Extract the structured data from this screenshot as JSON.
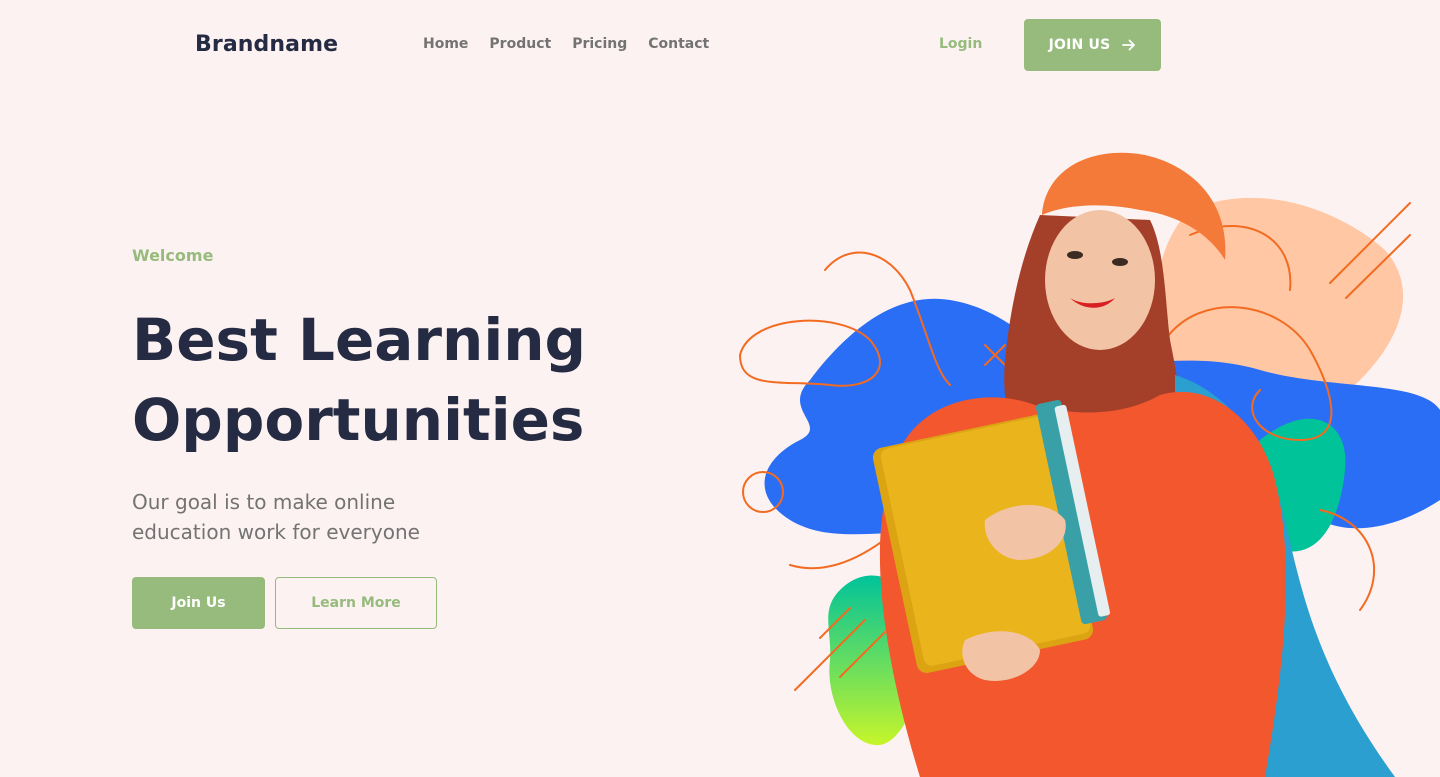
{
  "header": {
    "brand": "Brandname",
    "nav": [
      "Home",
      "Product",
      "Pricing",
      "Contact"
    ],
    "login_label": "Login",
    "join_label": "JOIN US"
  },
  "hero": {
    "eyebrow": "Welcome",
    "title_line1": "Best Learning",
    "title_line2": "Opportunities",
    "subtitle": "Our goal is to make online education work for everyone",
    "primary_button": "Join Us",
    "secondary_button": "Learn More"
  },
  "colors": {
    "background": "#fdf2f2",
    "accent": "#96bb7c",
    "heading": "#252b42",
    "muted": "#737373",
    "blob_blue": "#2a6ef5",
    "blob_peach": "#ffc7a3",
    "blob_green": "#00c39a",
    "line_orange": "#f26b21"
  },
  "icons": {
    "join_arrow": "arrow-right-icon"
  }
}
